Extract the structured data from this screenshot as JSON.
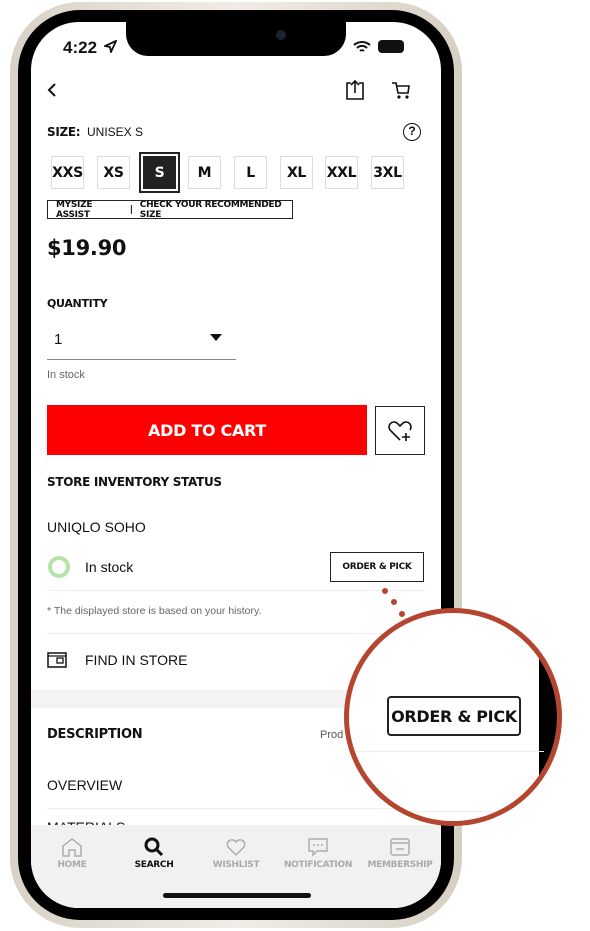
{
  "status": {
    "time": "4:22"
  },
  "size": {
    "label": "SIZE:",
    "value": "UNISEX S",
    "options": [
      "XXS",
      "XS",
      "S",
      "M",
      "L",
      "XL",
      "XXL",
      "3XL"
    ],
    "selected": "S"
  },
  "mysize": {
    "left": "MYSIZE ASSIST",
    "right": "CHECK YOUR RECOMMENDED SIZE"
  },
  "price": "$19.90",
  "quantity": {
    "label": "QUANTITY",
    "value": "1",
    "stock": "In stock"
  },
  "add_to_cart": "ADD TO CART",
  "store": {
    "heading": "STORE INVENTORY STATUS",
    "name": "UNIQLO SOHO",
    "status": "In stock",
    "order_pick": "ORDER & PICK",
    "note": "* The displayed store is based on your history.",
    "find": "FIND IN STORE"
  },
  "description": {
    "heading": "DESCRIPTION",
    "product_truncated": "Prod",
    "overview": "OVERVIEW",
    "materials": "MATERIALS"
  },
  "magnifier": {
    "label": "ORDER & PICK"
  },
  "tabs": [
    {
      "label": "HOME",
      "icon": "home-icon"
    },
    {
      "label": "SEARCH",
      "icon": "search-icon",
      "active": true
    },
    {
      "label": "WISHLIST",
      "icon": "heart-icon"
    },
    {
      "label": "NOTIFICATION",
      "icon": "chat-icon"
    },
    {
      "label": "MEMBERSHIP",
      "icon": "card-icon"
    }
  ],
  "colors": {
    "accent": "#ff0000",
    "in_stock": "#b5e3a5",
    "magnifier": "#b5452f"
  }
}
